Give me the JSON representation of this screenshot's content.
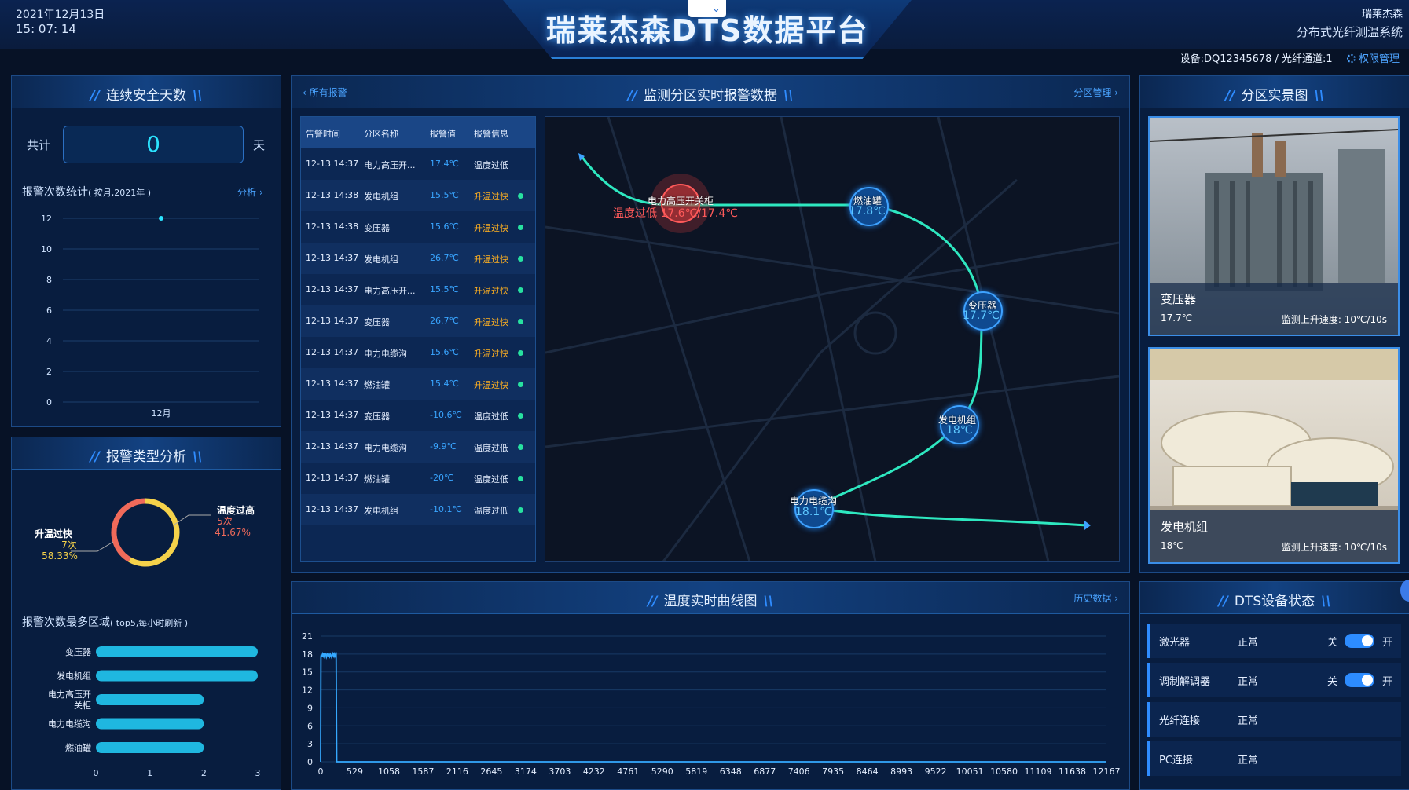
{
  "header": {
    "date": "2021年12月13日",
    "time": "15: 07: 14",
    "title": "瑞莱杰森DTS数据平台",
    "brand_top": "瑞莱杰森",
    "brand_sub": "分布式光纤测温系统",
    "window_minimize": "—",
    "window_expand": "⌄",
    "device_line": "设备:DQ12345678 / 光纤通道:1",
    "permission_label": "权限管理"
  },
  "safety": {
    "title": "连续安全天数",
    "total_label": "共计",
    "days_value": "0",
    "unit": "天"
  },
  "alarm_stats": {
    "title": "报警次数统计",
    "subtitle": "( 按月,2021年 )",
    "link": "分析 ›",
    "chart_data": {
      "type": "scatter",
      "categories": [
        "12月"
      ],
      "values": [
        12
      ],
      "ylim": [
        0,
        12
      ],
      "yticks": [
        "0",
        "2",
        "4",
        "6",
        "8",
        "10",
        "12"
      ]
    }
  },
  "alarm_type": {
    "title": "报警类型分析",
    "chart_data": {
      "type": "pie",
      "slices": [
        {
          "name": "升温过快",
          "count": "7次",
          "percent": "58.33%",
          "value": 7,
          "color": "#f5d24a"
        },
        {
          "name": "温度过高",
          "count": "5次",
          "percent": "41.67%",
          "value": 5,
          "color": "#f06a5a"
        }
      ]
    }
  },
  "top_zones": {
    "title": "报警次数最多区域",
    "subtitle": "( top5,每小时刷新 )",
    "chart_data": {
      "type": "bar",
      "categories": [
        "变压器",
        "发电机组",
        "电力高压开关柜",
        "电力电缆沟",
        "燃油罐"
      ],
      "category_lines": [
        [
          "变压器"
        ],
        [
          "发电机组"
        ],
        [
          "电力高压开",
          "关柜"
        ],
        [
          "电力电缆沟"
        ],
        [
          "燃油罐"
        ]
      ],
      "values": [
        3,
        3,
        2,
        2,
        2
      ],
      "xlim": [
        0,
        3
      ],
      "xticks": [
        "0",
        "1",
        "2",
        "3"
      ]
    }
  },
  "realtime_alarms": {
    "back_link": "‹ 所有报警",
    "title": "监测分区实时报警数据",
    "manage_link": "分区管理 ›",
    "columns": [
      "告警时间",
      "分区名称",
      "报警值",
      "报警信息"
    ],
    "rows": [
      {
        "time": "12-13 14:37",
        "zone": "电力高压开...",
        "value": "17.4℃",
        "info": "温度过低",
        "warn": false,
        "dot": false
      },
      {
        "time": "12-13 14:38",
        "zone": "发电机组",
        "value": "15.5℃",
        "info": "升温过快",
        "warn": true,
        "dot": true
      },
      {
        "time": "12-13 14:38",
        "zone": "变压器",
        "value": "15.6℃",
        "info": "升温过快",
        "warn": true,
        "dot": true
      },
      {
        "time": "12-13 14:37",
        "zone": "发电机组",
        "value": "26.7℃",
        "info": "升温过快",
        "warn": true,
        "dot": true
      },
      {
        "time": "12-13 14:37",
        "zone": "电力高压开...",
        "value": "15.5℃",
        "info": "升温过快",
        "warn": true,
        "dot": true
      },
      {
        "time": "12-13 14:37",
        "zone": "变压器",
        "value": "26.7℃",
        "info": "升温过快",
        "warn": true,
        "dot": true
      },
      {
        "time": "12-13 14:37",
        "zone": "电力电缆沟",
        "value": "15.6℃",
        "info": "升温过快",
        "warn": true,
        "dot": true
      },
      {
        "time": "12-13 14:37",
        "zone": "燃油罐",
        "value": "15.4℃",
        "info": "升温过快",
        "warn": true,
        "dot": true
      },
      {
        "time": "12-13 14:37",
        "zone": "变压器",
        "value": "-10.6℃",
        "info": "温度过低",
        "warn": false,
        "dot": true
      },
      {
        "time": "12-13 14:37",
        "zone": "电力电缆沟",
        "value": "-9.9℃",
        "info": "温度过低",
        "warn": false,
        "dot": true
      },
      {
        "time": "12-13 14:37",
        "zone": "燃油罐",
        "value": "-20℃",
        "info": "温度过低",
        "warn": false,
        "dot": true
      },
      {
        "time": "12-13 14:37",
        "zone": "发电机组",
        "value": "-10.1℃",
        "info": "温度过低",
        "warn": false,
        "dot": true
      }
    ]
  },
  "map": {
    "alarm_node": {
      "name": "电力高压开关柜",
      "text": "温度过低 17.6℃/17.4℃"
    },
    "nodes": [
      {
        "name": "燃油罐",
        "value": "17.8℃"
      },
      {
        "name": "变压器",
        "value": "17.7℃"
      },
      {
        "name": "发电机组",
        "value": "18℃"
      },
      {
        "name": "电力电缆沟",
        "value": "18.1℃"
      }
    ]
  },
  "photos": {
    "title": "分区实景图",
    "items": [
      {
        "name": "变压器",
        "temp": "17.7℃",
        "rate": "监测上升速度: 10℃/10s"
      },
      {
        "name": "发电机组",
        "temp": "18℃",
        "rate": "监测上升速度: 10℃/10s"
      }
    ]
  },
  "curve": {
    "title": "温度实时曲线图",
    "link": "历史数据 ›",
    "chart_data": {
      "type": "line",
      "x": [
        0,
        5,
        10,
        20,
        30,
        40,
        50,
        60,
        70,
        80,
        90,
        100,
        110,
        120,
        130,
        140,
        150,
        160,
        170,
        180,
        190,
        200,
        210,
        220,
        230,
        240,
        250,
        12200
      ],
      "y": [
        0,
        17.6,
        17.9,
        17.5,
        18.0,
        17.7,
        18.1,
        17.6,
        17.9,
        18.0,
        17.5,
        17.8,
        18.2,
        17.7,
        17.9,
        17.6,
        18.0,
        17.8,
        17.5,
        17.9,
        18.1,
        17.7,
        18.0,
        17.6,
        17.9,
        18.3,
        0,
        0
      ],
      "xlim": [
        0,
        12200
      ],
      "ylim": [
        0,
        21
      ],
      "xticks": [
        "0",
        "529",
        "1058",
        "1587",
        "2116",
        "2645",
        "3174",
        "3703",
        "4232",
        "4761",
        "5290",
        "5819",
        "6348",
        "6877",
        "7406",
        "7935",
        "8464",
        "8993",
        "9522",
        "10051",
        "10580",
        "11109",
        "11638",
        "12167"
      ],
      "yticks": [
        "0",
        "3",
        "6",
        "9",
        "12",
        "15",
        "18",
        "21"
      ]
    }
  },
  "device_status": {
    "title": "DTS设备状态",
    "off_label": "关",
    "on_label": "开",
    "items": [
      {
        "name": "激光器",
        "state": "正常",
        "toggle": true
      },
      {
        "name": "调制解调器",
        "state": "正常",
        "toggle": true
      },
      {
        "name": "光纤连接",
        "state": "正常",
        "toggle": false
      },
      {
        "name": "PC连接",
        "state": "正常",
        "toggle": false
      }
    ]
  }
}
